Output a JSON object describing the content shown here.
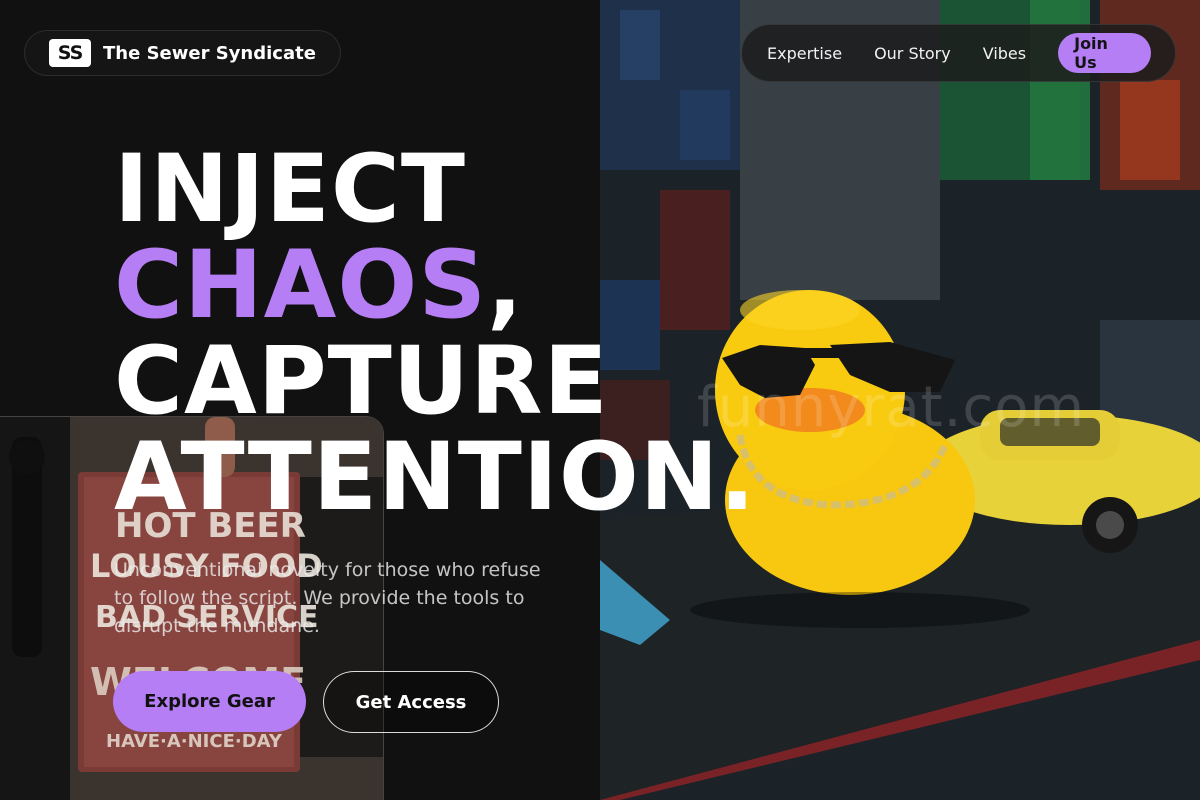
{
  "brand": {
    "logo_text": "SS",
    "name": "The Sewer Syndicate"
  },
  "nav": {
    "links": [
      "Expertise",
      "Our Story",
      "Vibes"
    ],
    "cta": "Join Us"
  },
  "hero": {
    "headline_line1": "INJECT",
    "headline_accent": "CHAOS",
    "headline_comma": ",",
    "headline_line3": "CAPTURE",
    "headline_line4": "ATTENTION.",
    "subcopy": "Unconventional novelty for those who refuse to follow the script. We provide the tools to disrupt the mundane.",
    "primary_button": "Explore Gear",
    "secondary_button": "Get Access"
  },
  "images": {
    "right_photo": "rubber-duck-with-sunglasses-and-gold-chain",
    "left_photo": "hot-beer-lousy-food-sign",
    "sign_lines": [
      "HOT BEER",
      "LOUSY FOOD",
      "BAD SERVICE",
      "WELCOME",
      "HAVE·A·NICE·DAY"
    ],
    "watermark": "funnyrat.com"
  },
  "colors": {
    "accent": "#b57ef5",
    "background": "#111111",
    "text": "#ffffff"
  }
}
